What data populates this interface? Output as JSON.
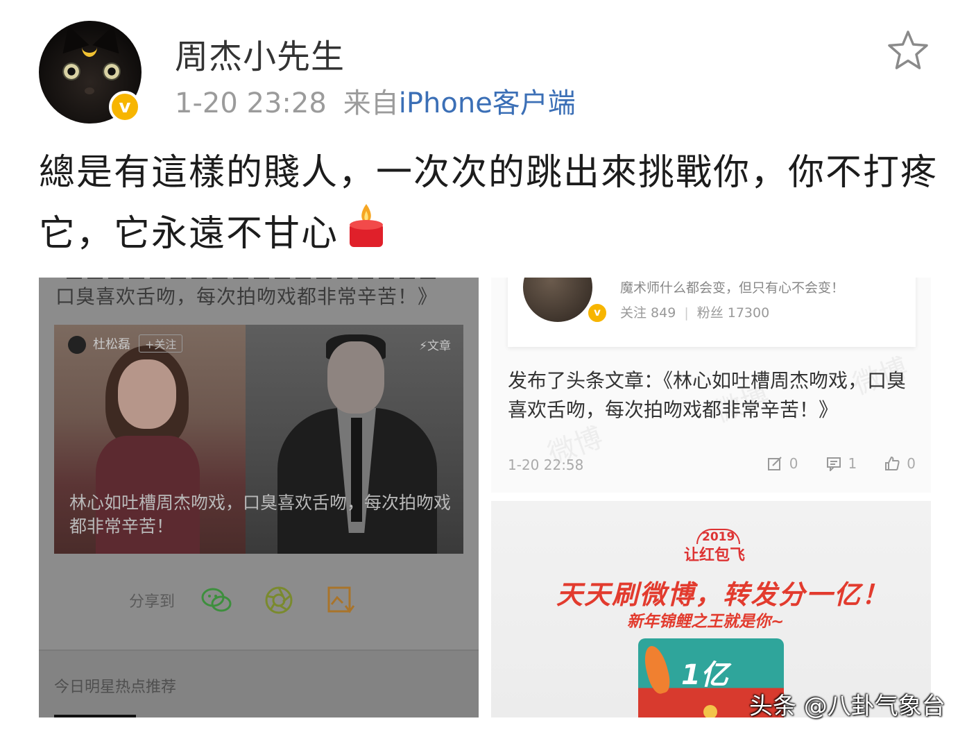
{
  "post": {
    "username": "周杰小先生",
    "time": "1-20 23:28",
    "source_prefix": "来自",
    "source": "iPhone客户端",
    "text": "總是有這樣的賤人，一次次的跳出來挑戰你，你不打疼它，它永遠不甘心",
    "verified": true
  },
  "left_screenshot": {
    "headline_tail": "口臭喜欢舌吻，每次拍吻戏都非常辛苦！》",
    "card": {
      "author": "杜松磊",
      "follow_label": "+关注",
      "type_label": "⚡文章",
      "caption": "林心如吐槽周杰吻戏，口臭喜欢舌吻，每次拍吻戏都非常辛苦！"
    },
    "share_label": "分享到",
    "share_icons": [
      "wechat-icon",
      "moments-icon",
      "save-image-icon"
    ],
    "hot_section_label": "今日明星热点推荐"
  },
  "right_screenshot": {
    "profile": {
      "bio": "魔术师什么都会变，但只有心不会变！",
      "following": "关注 849",
      "followers": "粉丝 17300"
    },
    "published_text": "发布了头条文章：《林心如吐槽周杰吻戏，口臭喜欢舌吻，每次拍吻戏都非常辛苦！》",
    "time": "1-20 22:58",
    "actions": {
      "repost": "0",
      "comment": "1",
      "like": "0"
    }
  },
  "promo": {
    "badge_year": "2019",
    "badge_name": "让红包飞",
    "title": "天天刷微博，转发分一亿！",
    "subtitle": "新年锦鲤之王就是你~",
    "envelope_text": "1亿"
  },
  "source_watermark": "头条 @八卦气象台",
  "colors": {
    "link_blue": "#3b6fb6",
    "verified_badge": "#f7b500",
    "promo_red": "#e23b2e"
  }
}
